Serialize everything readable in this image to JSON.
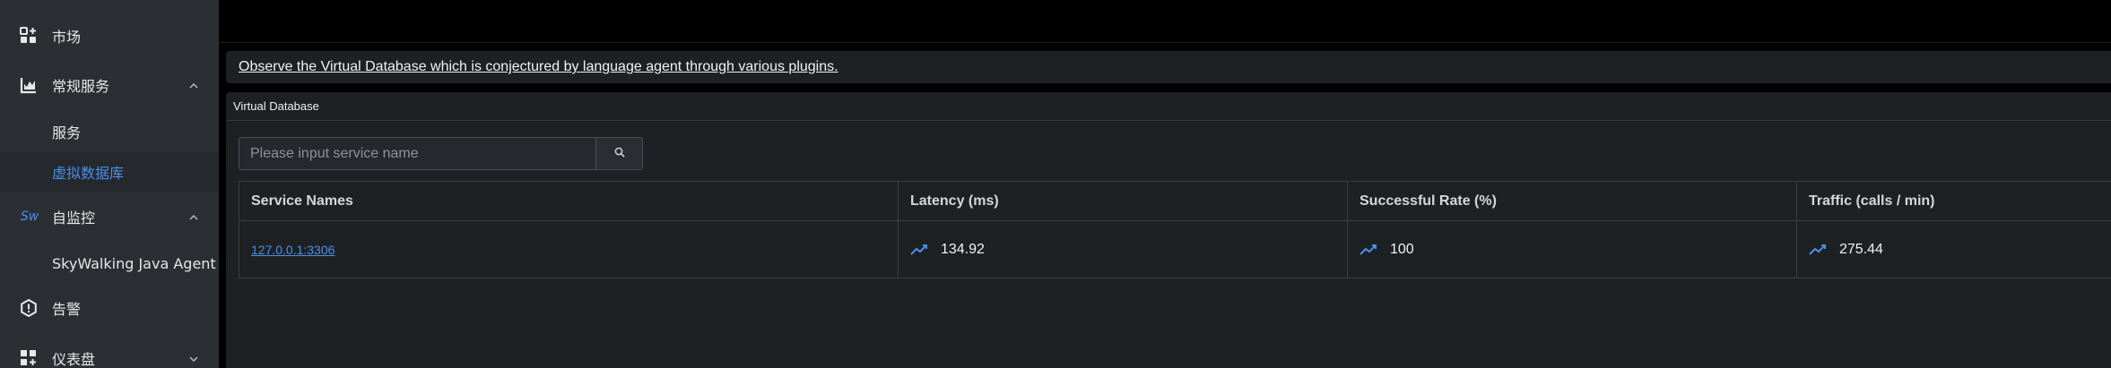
{
  "sidebar": {
    "items": [
      {
        "label": "市场",
        "icon": "apps-icon"
      },
      {
        "label": "常规服务",
        "icon": "chart-icon"
      },
      {
        "label": "服务"
      },
      {
        "label": "虚拟数据库"
      },
      {
        "label": "自监控",
        "icon": "skywalking-logo-icon",
        "logo_text": "Sw"
      },
      {
        "label": "SkyWalking Java Agent"
      },
      {
        "label": "告警",
        "icon": "alert-icon"
      },
      {
        "label": "仪表盘",
        "icon": "dashboard-icon"
      }
    ]
  },
  "banner": {
    "text": "Observe the Virtual Database which is conjectured by language agent through various plugins."
  },
  "panel": {
    "title": "Virtual Database"
  },
  "search": {
    "placeholder": "Please input service name",
    "value": ""
  },
  "table": {
    "columns": [
      "Service Names",
      "Latency (ms)",
      "Successful Rate (%)",
      "Traffic (calls / min)"
    ],
    "rows": [
      {
        "service": "127.0.0.1:3306",
        "latency": "134.92",
        "success_rate": "100",
        "traffic": "275.44"
      }
    ]
  },
  "colors": {
    "accent": "#4a8fe8",
    "sidebar_bg": "#2b2f33",
    "panel_bg": "#1e2124"
  }
}
